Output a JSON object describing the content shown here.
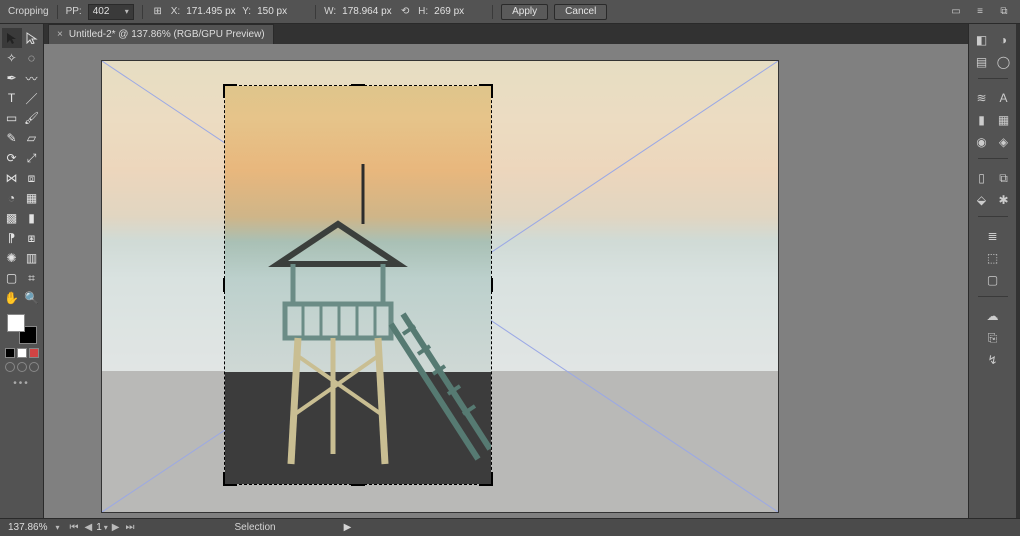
{
  "options": {
    "tool_label": "Cropping",
    "ppi_label": "PP:",
    "ppi_value": "402",
    "x_label": "X:",
    "x_value": "171.495 px",
    "y_label": "Y:",
    "y_value": "150 px",
    "w_label": "W:",
    "w_value": "178.964 px",
    "h_label": "H:",
    "h_value": "269 px",
    "apply": "Apply",
    "cancel": "Cancel"
  },
  "tab": {
    "close_glyph": "×",
    "title": "Untitled-2* @ 137.86% (RGB/GPU Preview)"
  },
  "colors": {
    "foreground": "#ffffff",
    "background": "#000000"
  },
  "status": {
    "zoom": "137.86%",
    "page": "1",
    "selection_label": "Selection",
    "play_glyph": "▶"
  },
  "icons": {
    "reference_point": "⊞",
    "link_wh": "⟲",
    "doc_setup": "▭",
    "prefs": "≡",
    "arrange": "⧉"
  }
}
